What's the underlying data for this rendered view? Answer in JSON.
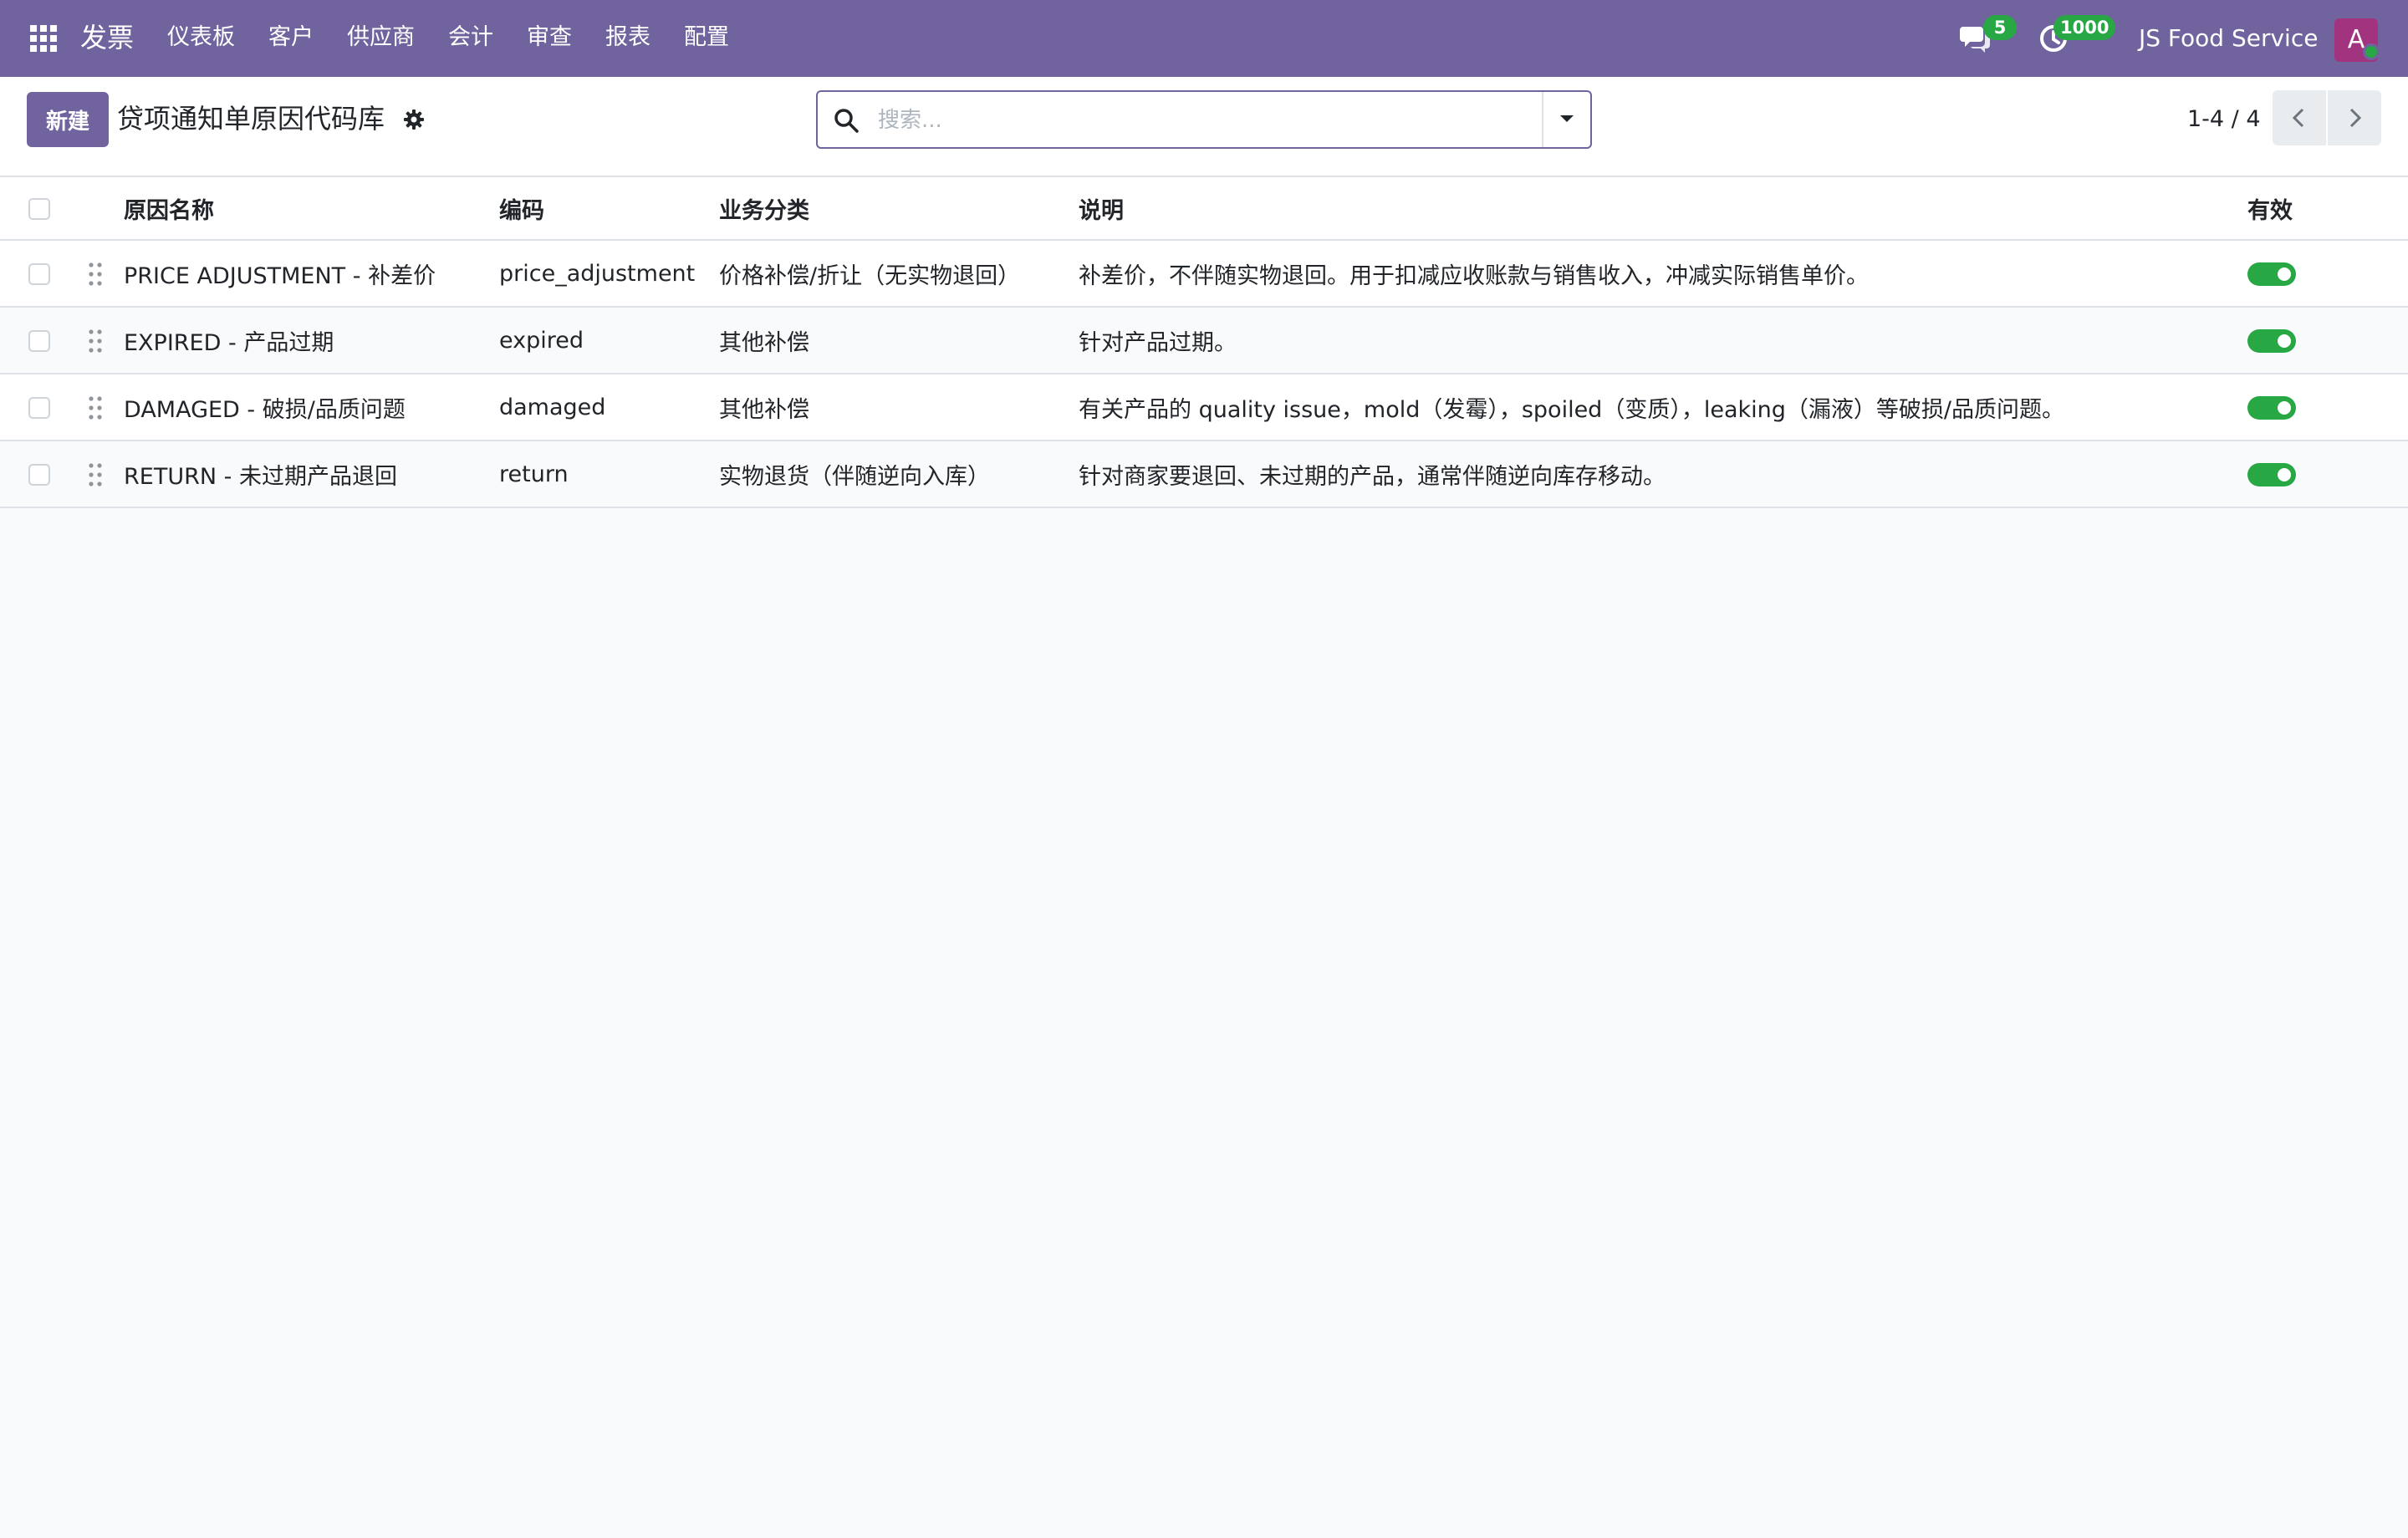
{
  "navbar": {
    "app_title": "发票",
    "menu": [
      "仪表板",
      "客户",
      "供应商",
      "会计",
      "审查",
      "报表",
      "配置"
    ],
    "chat_count": "5",
    "activity_count": "1000",
    "company": "JS Food Service",
    "avatar_letter": "A"
  },
  "control_panel": {
    "new_label": "新建",
    "title": "贷项通知单原因代码库",
    "search_placeholder": "搜索...",
    "pager": "1-4 / 4"
  },
  "table": {
    "headers": {
      "name": "原因名称",
      "code": "编码",
      "category": "业务分类",
      "description": "说明",
      "active": "有效"
    },
    "rows": [
      {
        "name": "PRICE ADJUSTMENT - 补差价",
        "code": "price_adjustment",
        "category": "价格补偿/折让（无实物退回）",
        "description": "补差价，不伴随实物退回。用于扣减应收账款与销售收入，冲减实际销售单价。",
        "active": true
      },
      {
        "name": "EXPIRED - 产品过期",
        "code": "expired",
        "category": "其他补偿",
        "description": "针对产品过期。",
        "active": true
      },
      {
        "name": "DAMAGED - 破损/品质问题",
        "code": "damaged",
        "category": "其他补偿",
        "description": "有关产品的 quality issue，mold（发霉），spoiled（变质），leaking（漏液）等破损/品质问题。",
        "active": true
      },
      {
        "name": "RETURN - 未过期产品退回",
        "code": "return",
        "category": "实物退货（伴随逆向入库）",
        "description": "针对商家要退回、未过期的产品，通常伴随逆向库存移动。",
        "active": true
      }
    ]
  },
  "colors": {
    "brand": "#71639e",
    "success": "#28a745",
    "avatar": "#a2337f"
  },
  "icons": [
    "apps-grid-icon",
    "chat-icon",
    "activity-clock-icon",
    "gear-icon",
    "search-icon",
    "caret-down-icon",
    "chevron-left-icon",
    "chevron-right-icon",
    "drag-handle-icon"
  ]
}
